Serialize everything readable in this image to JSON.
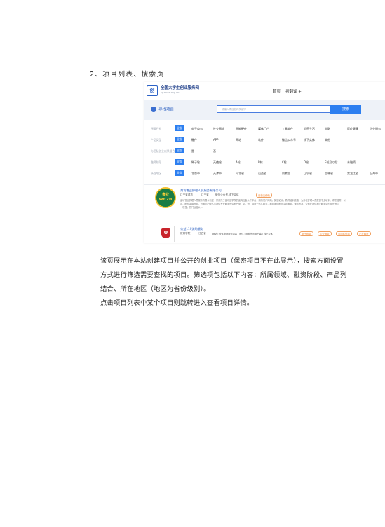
{
  "document": {
    "heading": "2、项目列表、搜索页",
    "paragraph_lines": [
      "该页展示在本站创建项目并公开的创业项目（保密项目不在此展示），搜索方面设置",
      "方式进行筛选需要查找的项目。筛选项包括以下内容：所属领域、融资阶段、产品列",
      "结合、所在地区（地区为省份级别）。",
      "点击项目列表中某个项目则跳转进入查看项目详情。"
    ]
  },
  "screenshot": {
    "logo_text": "创",
    "site_name": "全国大学生创业服务网",
    "site_url": "cy.ncss.org.cn",
    "nav": [
      "首页",
      "按翻译 +"
    ],
    "hero_title": "寻找项目",
    "search_placeholder": "请输入项目名称关键字",
    "search_button": "搜索",
    "filters": [
      {
        "label": "所属行业",
        "options": [
          "全部",
          "电子商务",
          "社交网络",
          "智能硬件",
          "媒体门户",
          "工具软件",
          "消费生活",
          "金融",
          "医疗健康",
          "企业服务"
        ]
      },
      {
        "label": "产品类型",
        "options": [
          "全部",
          "硬件",
          "APP",
          "网站",
          "软件",
          "微信公众号",
          "线下实体",
          "其他"
        ]
      },
      {
        "label": "与团队创业成果组合",
        "options": [
          "全部",
          "是",
          "否"
        ]
      },
      {
        "label": "融资阶段",
        "options": [
          "全部",
          "种子轮",
          "天使轮",
          "A轮",
          "B轮",
          "C轮",
          "D轮",
          "E轮及以后",
          "未融资"
        ]
      },
      {
        "label": "所在地区",
        "options": [
          "全部",
          "北京市",
          "天津市",
          "河北省",
          "山西省",
          "内蒙古",
          "辽宁省",
          "吉林省",
          "黑龙江省",
          "上海市"
        ]
      }
    ],
    "cards": [
      {
        "logo_lines": [
          "鲁业",
          "WE ZH"
        ],
        "title": "潍坊鲁业护理人员服务有限公司",
        "meta": [
          "辽宁省潍坊",
          "辽宁省",
          "微信公众号,线下实体"
        ],
        "tag": "已获天使轮",
        "desc": [
          "潍坊鲁业护理人员服务有限公司是一家依托于潍坊医学院的面向社会公开平台，拥有门户网站，微信站点，教育培训线路，为养老护理人员提供专业培训、求职招聘，以",
          "及，职业发展咨询，为潍坊护理人员提供专业服务的公司产品，文，研，同台一站式服务，利用潍坊职业生涯服务，微信号及，公司在提供相关服务中的领先地位",
          "一次性，热门运营公..."
        ]
      },
      {
        "logo_char": "U",
        "title": "公益110流动服务",
        "meta": [
          "教育学院",
          "江西省",
          "网站 | 全民流动服务内容 | 软件 | 网络的可用户端 | 线下实体"
        ],
        "tags": [
          "电子商务",
          "企业服务",
          "与团队结合",
          "正在融资"
        ]
      }
    ]
  }
}
